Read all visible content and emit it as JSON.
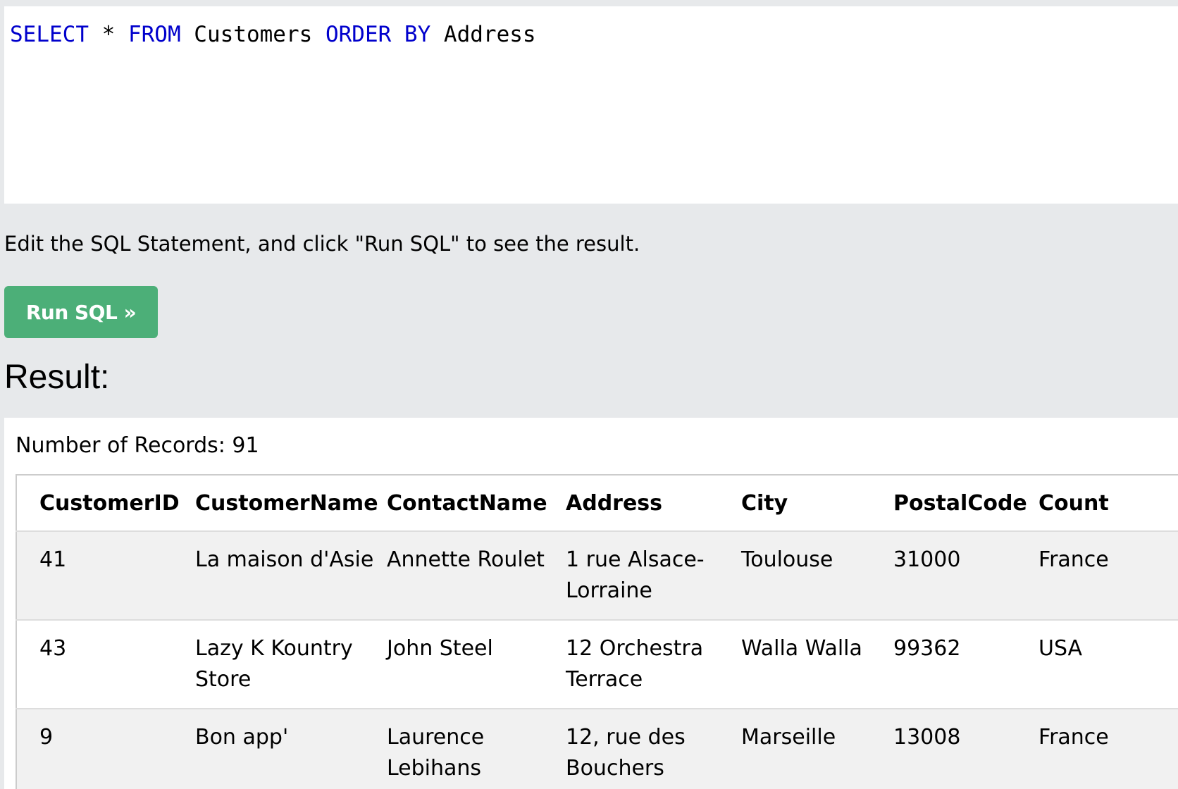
{
  "editor": {
    "tokens": [
      {
        "text": "SELECT",
        "kind": "keyword"
      },
      {
        "text": " * ",
        "kind": "plain"
      },
      {
        "text": "FROM",
        "kind": "keyword"
      },
      {
        "text": " Customers ",
        "kind": "plain"
      },
      {
        "text": "ORDER BY",
        "kind": "keyword"
      },
      {
        "text": " Address",
        "kind": "plain"
      }
    ]
  },
  "instructions": "Edit the SQL Statement, and click \"Run SQL\" to see the result.",
  "run_button": {
    "label": "Run SQL »"
  },
  "result": {
    "heading": "Result:",
    "record_count": "Number of Records: 91",
    "columns": [
      "CustomerID",
      "CustomerName",
      "ContactName",
      "Address",
      "City",
      "PostalCode",
      "Count"
    ],
    "rows": [
      [
        "41",
        "La maison d'Asie",
        "Annette Roulet",
        "1 rue Alsace-Lorraine",
        "Toulouse",
        "31000",
        "France"
      ],
      [
        "43",
        "Lazy K Kountry Store",
        "John Steel",
        "12 Orchestra Terrace",
        "Walla Walla",
        "99362",
        "USA"
      ],
      [
        "9",
        "Bon app'",
        "Laurence Lebihans",
        "12, rue des Bouchers",
        "Marseille",
        "13008",
        "France"
      ]
    ]
  },
  "colors": {
    "keyword": "#0000cc",
    "button_bg": "#4caf78",
    "page_bg": "#e7e9eb",
    "row_alt_bg": "#f1f1f1"
  }
}
